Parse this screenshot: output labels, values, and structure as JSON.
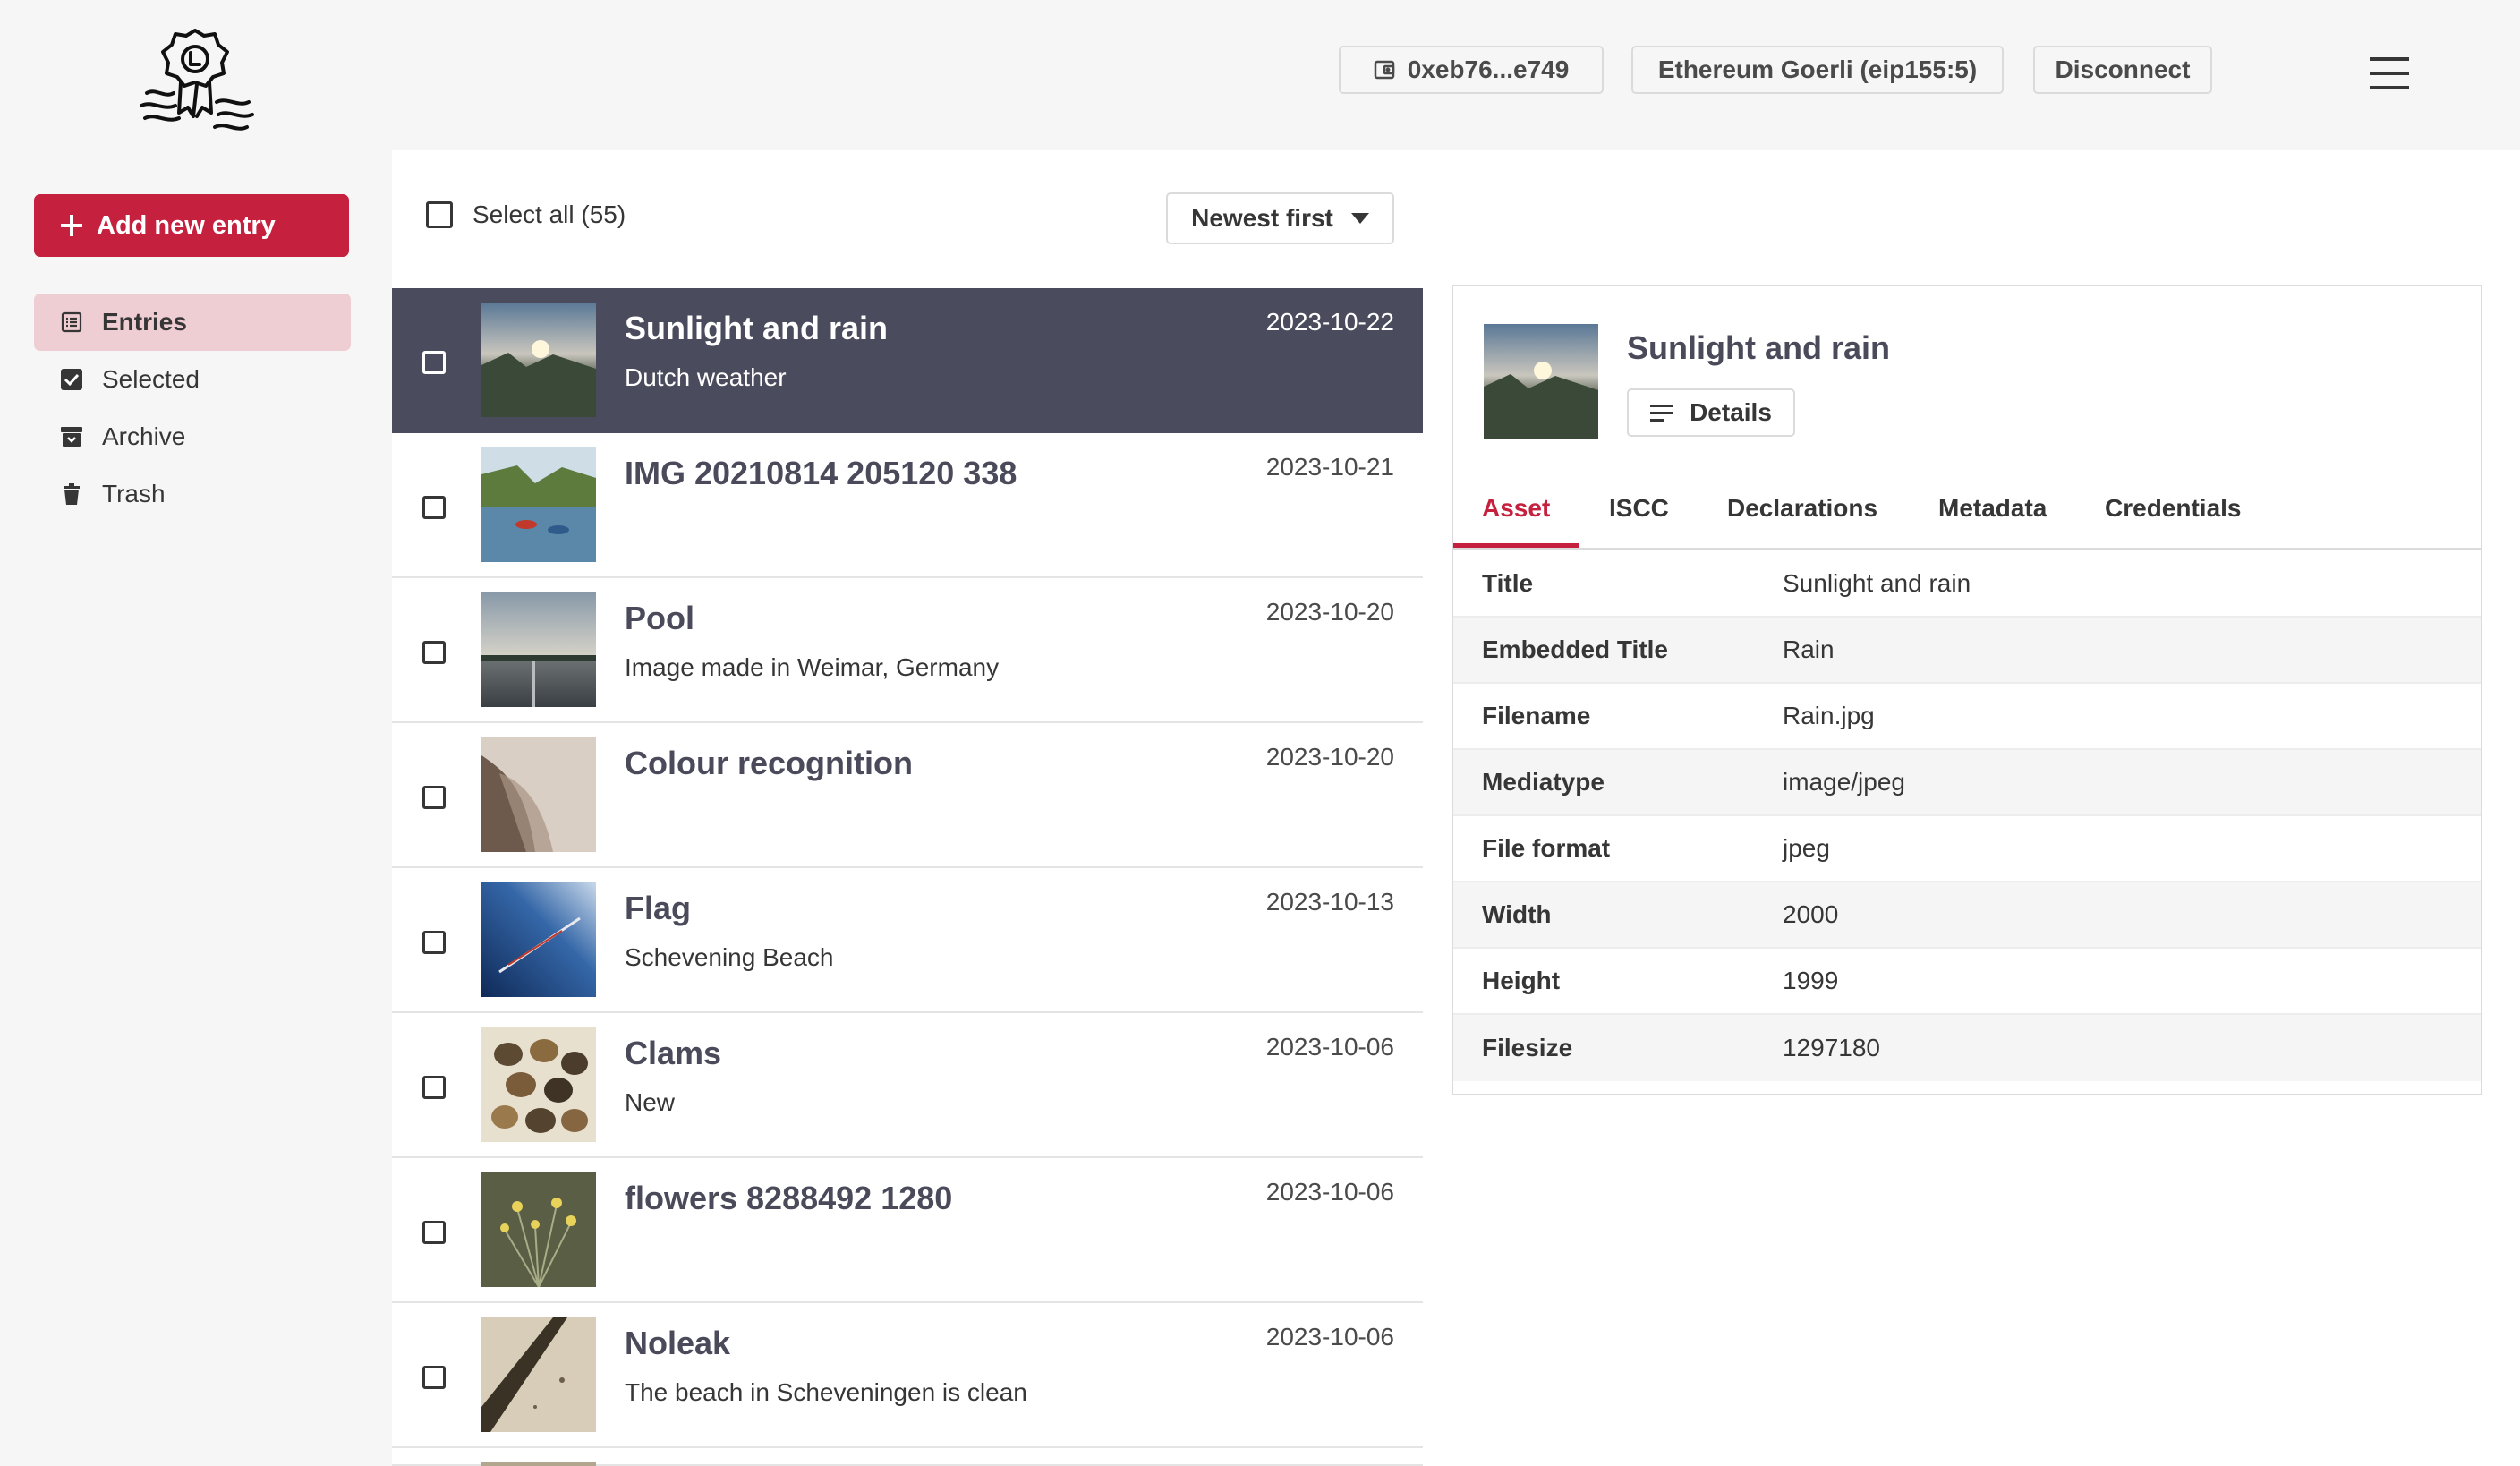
{
  "header": {
    "wallet_address": "0xeb76...e749",
    "network": "Ethereum Goerli (eip155:5)",
    "disconnect_label": "Disconnect",
    "menu_icon": "hamburger-icon"
  },
  "sidebar": {
    "add_label": "Add new entry",
    "items": [
      {
        "label": "Entries",
        "icon": "list-icon"
      },
      {
        "label": "Selected",
        "icon": "checkbox-checked-icon"
      },
      {
        "label": "Archive",
        "icon": "archive-icon"
      },
      {
        "label": "Trash",
        "icon": "trash-icon"
      }
    ]
  },
  "toolbar": {
    "select_all_label": "Select all (55)",
    "sort_label": "Newest first"
  },
  "entries": [
    {
      "title": "Sunlight and rain",
      "subtitle": "Dutch weather",
      "date": "2023-10-22"
    },
    {
      "title": "IMG 20210814 205120 338",
      "subtitle": "",
      "date": "2023-10-21"
    },
    {
      "title": "Pool",
      "subtitle": "Image made in Weimar, Germany",
      "date": "2023-10-20"
    },
    {
      "title": "Colour recognition",
      "subtitle": "",
      "date": "2023-10-20"
    },
    {
      "title": "Flag",
      "subtitle": "Schevening Beach",
      "date": "2023-10-13"
    },
    {
      "title": "Clams",
      "subtitle": "New",
      "date": "2023-10-06"
    },
    {
      "title": "flowers 8288492 1280",
      "subtitle": "",
      "date": "2023-10-06"
    },
    {
      "title": "Noleak",
      "subtitle": "The beach in Scheveningen is clean",
      "date": "2023-10-06"
    }
  ],
  "detail": {
    "title": "Sunlight and rain",
    "details_label": "Details",
    "tabs": [
      "Asset",
      "ISCC",
      "Declarations",
      "Metadata",
      "Credentials"
    ],
    "active_tab": "Asset",
    "properties": [
      {
        "key": "Title",
        "value": "Sunlight and rain"
      },
      {
        "key": "Embedded Title",
        "value": "Rain"
      },
      {
        "key": "Filename",
        "value": "Rain.jpg"
      },
      {
        "key": "Mediatype",
        "value": "image/jpeg"
      },
      {
        "key": "File format",
        "value": "jpeg"
      },
      {
        "key": "Width",
        "value": "2000"
      },
      {
        "key": "Height",
        "value": "1999"
      },
      {
        "key": "Filesize",
        "value": "1297180"
      }
    ]
  },
  "colors": {
    "accent": "#c5203e",
    "selected_row": "#4a4b5c",
    "active_nav": "#eecdd3"
  }
}
